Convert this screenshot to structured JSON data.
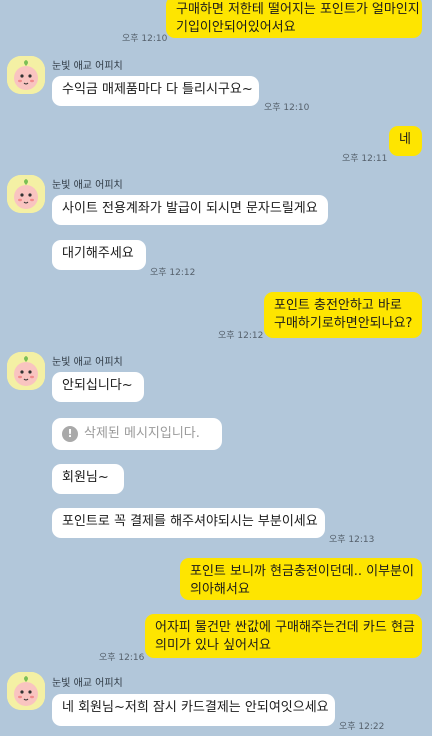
{
  "messages": {
    "m1": {
      "text1": "구매하면 저한테 떨어지는 포인트가 얼마인지",
      "text2": "기입이안되어있어서요",
      "time": "오후 12:10"
    },
    "p1": {
      "sender": "눈빛 애교 어피치"
    },
    "m2": {
      "text": "수익금 매제품마다 다 틀리시구요~",
      "time": "오후 12:10"
    },
    "m3": {
      "text": "네",
      "time": "오후 12:11"
    },
    "p2": {
      "sender": "눈빛 애교 어피치"
    },
    "m4": {
      "text": "사이트 전용계좌가 발급이 되시면 문자드릴게요"
    },
    "m5": {
      "text": "대기해주세요",
      "time": "오후 12:12"
    },
    "m6": {
      "text1": "포인트 충전안하고 바로",
      "text2": "구매하기로하면안되나요?",
      "time": "오후 12:12"
    },
    "p3": {
      "sender": "눈빛 애교 어피치"
    },
    "m7": {
      "text": "안되십니다~"
    },
    "m8": {
      "text": "삭제된 메시지입니다."
    },
    "m9": {
      "text": "회원님~"
    },
    "m10": {
      "text": "포인트로 꼭 결제를 해주셔야되시는 부분이세요",
      "time": "오후 12:13"
    },
    "m11": {
      "text1": "포인트 보니까 현금충전이던데.. 이부분이",
      "text2": "의아해서요"
    },
    "m12": {
      "text1": "어자피 물건만 싼값에 구매해주는건데 카드 현금",
      "text2": "의미가 있나 싶어서요",
      "time": "오후 12:16"
    },
    "p4": {
      "sender": "눈빛 애교 어피치"
    },
    "m13": {
      "text": "네 회원님~저희 잠시 카드결제는 안되여잇으세요",
      "time": "오후 12:22"
    }
  },
  "icons": {
    "avatar": "peach-character-avatar",
    "deleted": "exclamation-circle-icon"
  },
  "colors": {
    "background": "#b2c7da",
    "mine_bubble": "#fee500",
    "their_bubble": "#ffffff"
  }
}
